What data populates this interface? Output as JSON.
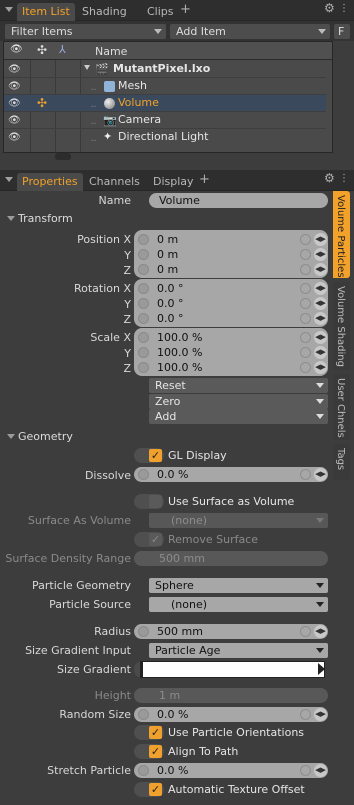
{
  "top_tabs": {
    "item_list": "Item List",
    "shading": "Shading",
    "clips": "Clips"
  },
  "toolbar": {
    "filter_items": "Filter Items",
    "add_item": "Add Item",
    "f_button": "F"
  },
  "list": {
    "name_header": "Name",
    "items": [
      {
        "name": "MutantPixel.lxo",
        "bold": true
      },
      {
        "name": "Mesh"
      },
      {
        "name": "Volume",
        "selected": true
      },
      {
        "name": "Camera"
      },
      {
        "name": "Directional Light"
      }
    ]
  },
  "bottom_tabs": {
    "properties": "Properties",
    "channels": "Channels",
    "display": "Display"
  },
  "side_tabs": {
    "volume_particles": "Volume Particles",
    "volume_shading": "Volume Shading",
    "user_channels": "User Chnels",
    "tags": "Tags"
  },
  "props": {
    "name_label": "Name",
    "name_value": "Volume",
    "transform_header": "Transform",
    "position_x_label": "Position X",
    "y_label": "Y",
    "z_label": "Z",
    "position": [
      "0 m",
      "0 m",
      "0 m"
    ],
    "rotation_x_label": "Rotation X",
    "rotation": [
      "0.0 °",
      "0.0 °",
      "0.0 °"
    ],
    "scale_x_label": "Scale X",
    "scale": [
      "100.0 %",
      "100.0 %",
      "100.0 %"
    ],
    "reset": "Reset",
    "zero": "Zero",
    "add": "Add",
    "geometry_header": "Geometry",
    "gl_display": "GL Display",
    "dissolve_label": "Dissolve",
    "dissolve_value": "0.0 %",
    "use_surface_as_volume": "Use Surface as Volume",
    "surface_as_volume_label": "Surface As Volume",
    "surface_as_volume_value": "(none)",
    "remove_surface": "Remove Surface",
    "surface_density_range_label": "Surface Density Range",
    "surface_density_range_value": "500 mm",
    "particle_geometry_label": "Particle Geometry",
    "particle_geometry_value": "Sphere",
    "particle_source_label": "Particle Source",
    "particle_source_value": "(none)",
    "radius_label": "Radius",
    "radius_value": "500 mm",
    "size_gradient_input_label": "Size Gradient Input",
    "size_gradient_input_value": "Particle Age",
    "size_gradient_label": "Size Gradient",
    "height_label": "Height",
    "height_value": "1 m",
    "random_size_label": "Random Size",
    "random_size_value": "0.0 %",
    "use_particle_orientations": "Use Particle Orientations",
    "align_to_path": "Align To Path",
    "stretch_particle_label": "Stretch Particle",
    "stretch_particle_value": "0.0 %",
    "automatic_texture_offset": "Automatic Texture Offset"
  },
  "colors": {
    "accent": "#f2a12a",
    "field": "#a7a7a7",
    "panel": "#3d3d3d",
    "selected_row": "#3a4a5c"
  }
}
